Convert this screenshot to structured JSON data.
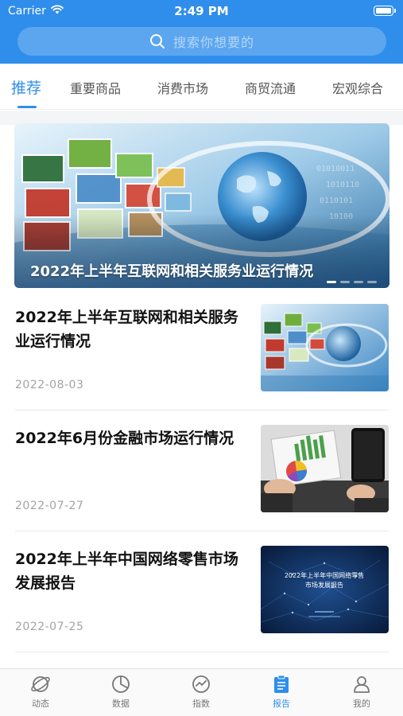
{
  "status_bar": {
    "carrier": "Carrier",
    "time": "2:49 PM"
  },
  "search": {
    "placeholder": "搜索你想要的",
    "icon": "search-icon"
  },
  "tabs": [
    {
      "label": "推荐",
      "active": true
    },
    {
      "label": "重要商品",
      "active": false
    },
    {
      "label": "消费市场",
      "active": false
    },
    {
      "label": "商贸流通",
      "active": false
    },
    {
      "label": "宏观综合",
      "active": false
    }
  ],
  "banner": {
    "caption": "2022年上半年互联网和相关服务业运行情况",
    "slides": 4,
    "current": 1
  },
  "articles": [
    {
      "title": "2022年上半年互联网和相关服务业运行情况",
      "date": "2022-08-03",
      "image": "internet-globe-image"
    },
    {
      "title": "2022年6月份金融市场运行情况",
      "date": "2022-07-27",
      "image": "finance-charts-image"
    },
    {
      "title": "2022年上半年中国网络零售市场发展报告",
      "date": "2022-07-25",
      "image": "report-cover-image",
      "image_text": {
        "line1": "2022年上半年中国网络零售",
        "line2": "市场发展报告"
      }
    }
  ],
  "tab_bar": [
    {
      "label": "动态",
      "icon": "planet-icon",
      "active": false
    },
    {
      "label": "数据",
      "icon": "pie-chart-icon",
      "active": false
    },
    {
      "label": "指数",
      "icon": "trend-circle-icon",
      "active": false
    },
    {
      "label": "报告",
      "icon": "clipboard-icon",
      "active": true
    },
    {
      "label": "我的",
      "icon": "user-icon",
      "active": false
    }
  ],
  "colors": {
    "brand": "#2f8eec",
    "text": "#111111",
    "muted": "#a3a3a3"
  }
}
